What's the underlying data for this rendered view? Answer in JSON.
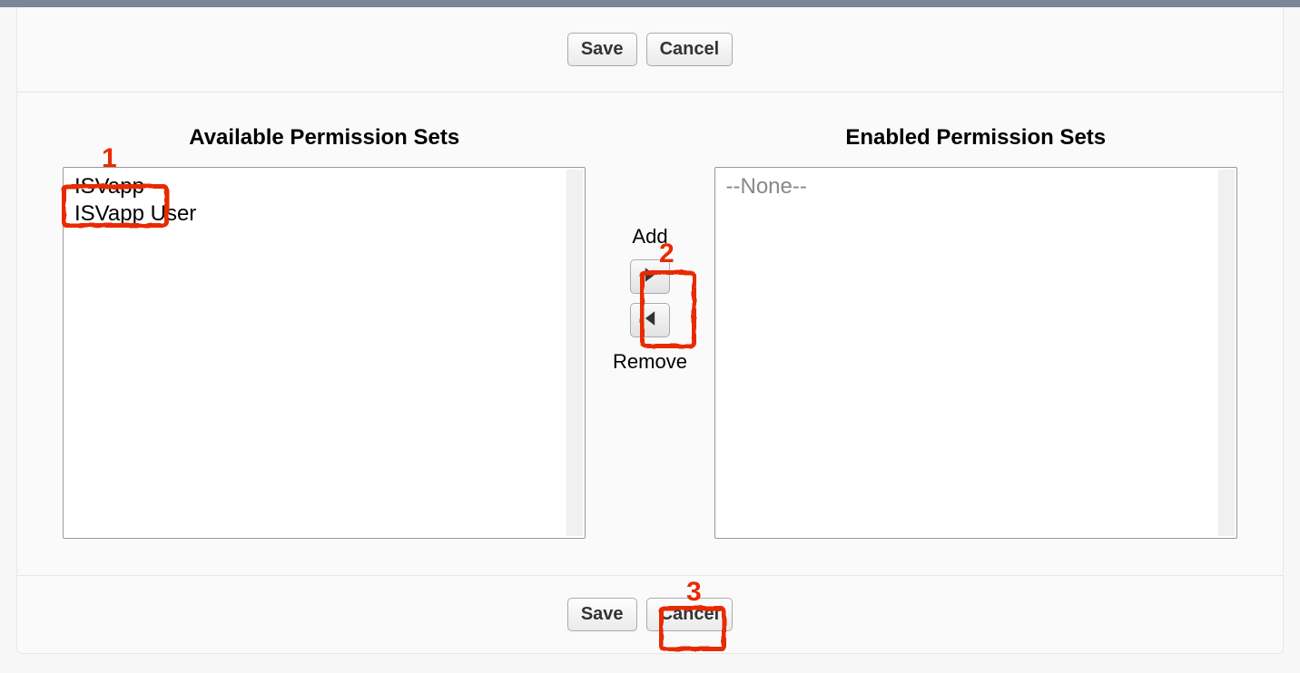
{
  "buttons": {
    "save": "Save",
    "cancel": "Cancel"
  },
  "duelingList": {
    "available": {
      "header": "Available Permission Sets",
      "options": [
        "ISVapp",
        "ISVapp User"
      ]
    },
    "enabled": {
      "header": "Enabled Permission Sets",
      "placeholder": "--None--",
      "options": []
    },
    "addLabel": "Add",
    "removeLabel": "Remove"
  },
  "annotations": {
    "step1": "1",
    "step2": "2",
    "step3": "3"
  }
}
